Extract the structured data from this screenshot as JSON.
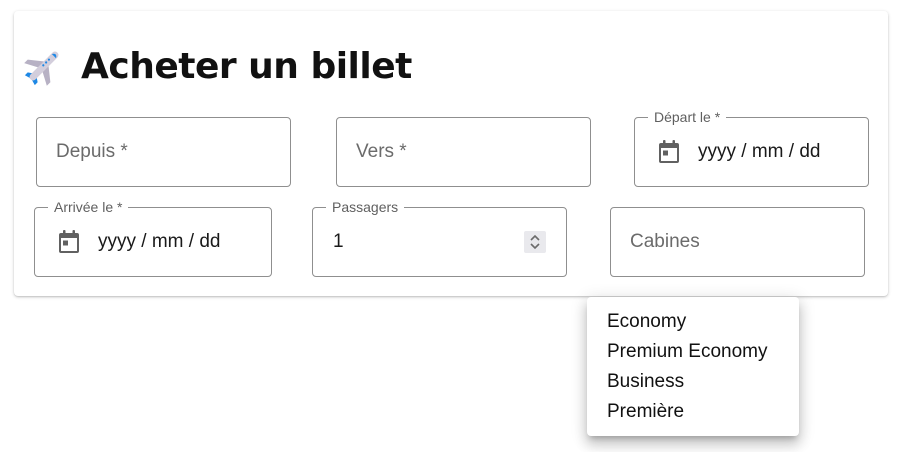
{
  "page": {
    "title": "Acheter un billet",
    "title_icon": "airplane-icon"
  },
  "form": {
    "from": {
      "placeholder": "Depuis *"
    },
    "to": {
      "placeholder": "Vers *"
    },
    "departure": {
      "label": "Départ le *",
      "value": "yyyy / mm / dd",
      "icon": "calendar-icon"
    },
    "arrival": {
      "label": "Arrivée le *",
      "value": "yyyy / mm / dd",
      "icon": "calendar-icon"
    },
    "passengers": {
      "label": "Passagers",
      "value": "1"
    },
    "cabins": {
      "placeholder": "Cabines"
    }
  },
  "cabin_menu": {
    "options": [
      "Economy",
      "Premium Economy",
      "Business",
      "Première"
    ]
  },
  "colors": {
    "border": "#8f8f8f",
    "placeholder": "#6b6b6b",
    "plane_body": "#c9c4d3",
    "plane_accent": "#1e88e5"
  }
}
